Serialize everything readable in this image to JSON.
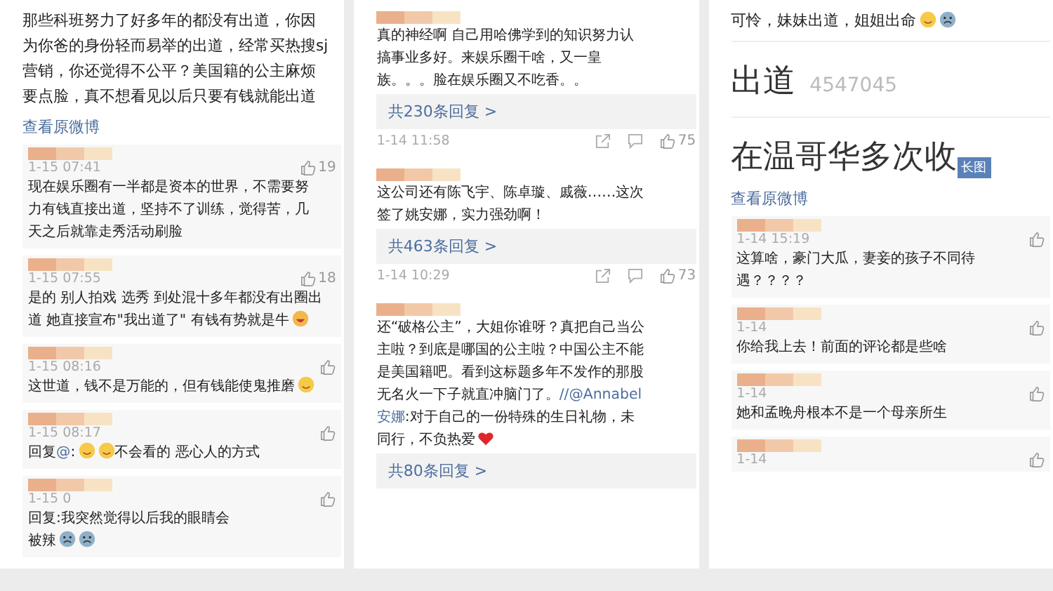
{
  "panels": [
    {
      "post": {
        "lines": [
          "那些科班努力了好多年的都没有出道，你因",
          "为你爸的身份轻而易举的出道，经常买热搜sj",
          "营销，你还觉得不公平？美国籍的公主麻烦",
          "要点脸，真不想看见以后只要有钱就能出道"
        ],
        "link": "查看原微博"
      },
      "comments": [
        {
          "time": "1-15 07:41",
          "likes": "19",
          "lines": [
            "现在娱乐圈有一半都是资本的世界，不需要努",
            "力有钱直接出道，坚持不了训练，觉得苦，几",
            "天之后就靠走秀活动刷脸"
          ]
        },
        {
          "time": "1-15 07:55",
          "likes": "18",
          "lines": [
            "是的 别人拍戏 选秀 到处混十多年都没有出圈出",
            "道 她直接宣布\"我出道了\" 有钱有势就是牛"
          ],
          "icons": [
            {
              "kind": "grin"
            }
          ]
        },
        {
          "time": "1-15 08:16",
          "lines": [
            "这世道，钱不是万能的，但有钱能使鬼推磨"
          ],
          "icons": [
            {
              "kind": "smile"
            }
          ]
        },
        {
          "time": "1-15 08:17",
          "lines": [
            [
              "回复",
              {
                "mention": "@"
              },
              ":"
            ]
          ],
          "icons": [
            {
              "kind": "smile"
            },
            {
              "kind": "smile"
            }
          ],
          "tail": "不会看的 恶心人的方式"
        },
        {
          "time": "1-15 0",
          "lines": [
            "回复:我突然觉得以后我的眼睛会",
            "被辣"
          ],
          "icons": [
            {
              "kind": "cry"
            },
            {
              "kind": "cry"
            }
          ]
        }
      ]
    },
    {
      "comments": [
        {
          "lines": [
            "真的神经啊 自己用哈佛学到的知识努力认",
            "搞事业多好。来娱乐圈干啥，又一皇",
            "族。。。脸在娱乐圈又不吃香。。"
          ],
          "replies": "共230条回复 >",
          "time": "1-14 11:58",
          "likes": "75"
        },
        {
          "lines": [
            "这公司还有陈飞宇、陈卓璇、戚薇……这次",
            "签了姚安娜，实力强劲啊！"
          ],
          "replies": "共463条回复 >",
          "time": "1-14 10:29",
          "likes": "73"
        },
        {
          "lines": [
            "还“破格公主”，大姐你谁呀？真把自己当公",
            "主啦？到底是哪国的公主啦？中国公主不能",
            "是美国籍吧。看到这标题多年不发作的那股",
            [
              "无名火一下子就直冲脑门了。",
              {
                "mention": "//@Annabel"
              }
            ],
            [
              {
                "mention": "安娜"
              },
              ":对于自己的一份特殊的生日礼物，未"
            ],
            "同行，不负热爱"
          ],
          "icons": [
            {
              "kind": "heart"
            }
          ],
          "replies": "共80条回复 >"
        }
      ]
    },
    {
      "post": {
        "lines": [
          "可怜，妹妹出道，姐姐出命"
        ],
        "icons": [
          {
            "kind": "smile"
          },
          {
            "kind": "cry"
          }
        ],
        "image": {
          "title": "出道",
          "number": "4547045",
          "caption": "在温哥华多次收",
          "badge": "长图"
        },
        "link": "查看原微博"
      },
      "comments": [
        {
          "time": "1-14 15:19",
          "lines": [
            "这算啥，豪门大瓜，妻妾的孩子不同待",
            "遇？？？？"
          ]
        },
        {
          "time": "1-14",
          "lines": [
            "你给我上去！前面的评论都是些啥"
          ]
        },
        {
          "time": "1-14",
          "lines": [
            "她和孟晚舟根本不是一个母亲所生"
          ]
        },
        {
          "time": "1-14"
        }
      ]
    }
  ]
}
